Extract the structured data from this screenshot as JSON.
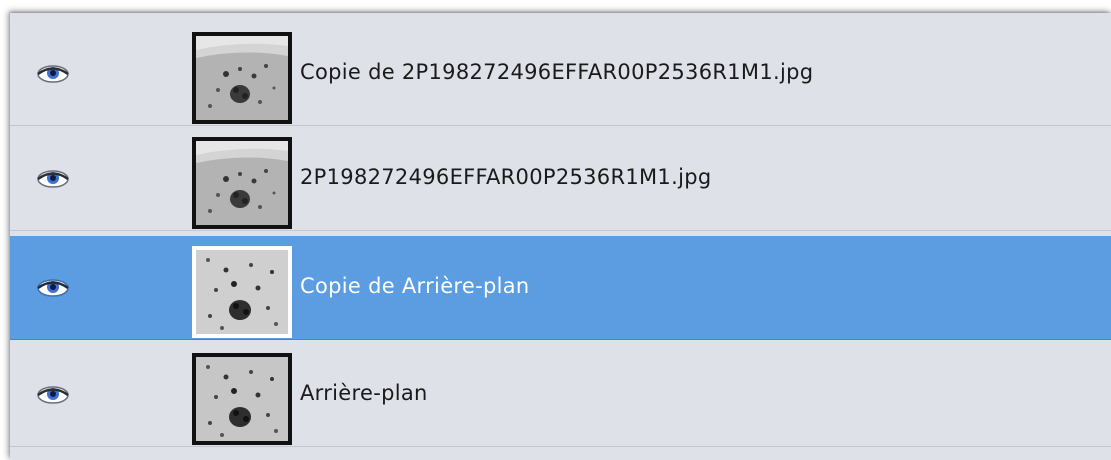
{
  "panel": {
    "colors": {
      "background": "#dfe1e8",
      "selected": "#5b9de0",
      "text": "#1a1a1a",
      "selected_text": "#ffffff"
    },
    "layers": [
      {
        "name": "Copie de 2P198272496EFFAR00P2536R1M1.jpg",
        "visible": true,
        "selected": false,
        "icon": "eye-icon"
      },
      {
        "name": "2P198272496EFFAR00P2536R1M1.jpg",
        "visible": true,
        "selected": false,
        "icon": "eye-icon"
      },
      {
        "name": "Copie de Arrière-plan",
        "visible": true,
        "selected": true,
        "icon": "eye-icon"
      },
      {
        "name": "Arrière-plan",
        "visible": true,
        "selected": false,
        "icon": "eye-icon"
      }
    ]
  }
}
